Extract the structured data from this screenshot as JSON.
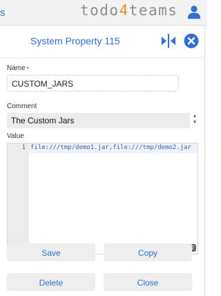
{
  "topbar": {
    "left_fragment": "s",
    "logo": {
      "prefix": "todo",
      "digit": "4",
      "suffix": "teams"
    }
  },
  "dialog": {
    "title": "System Property 115",
    "name_label": "Name",
    "required_mark": "•",
    "name_value": "CUSTOM_JARS",
    "comment_label": "Comment",
    "comment_value": "The Custom Jars",
    "value_label": "Value",
    "editor": {
      "line_number": "1",
      "code": "file:///tmp/demo1.jar,file:///tmp/demo2.jar",
      "cursor_position": "1:12"
    },
    "buttons": {
      "save": "Save",
      "copy": "Copy",
      "delete": "Delete",
      "close": "Close"
    }
  },
  "colors": {
    "accent": "#2f6fd6",
    "logo_digit": "#ea8a1e",
    "logo_text": "#8e8e8e"
  },
  "icons": {
    "user": "user-icon",
    "split": "split-view-icon",
    "close": "close-icon"
  }
}
